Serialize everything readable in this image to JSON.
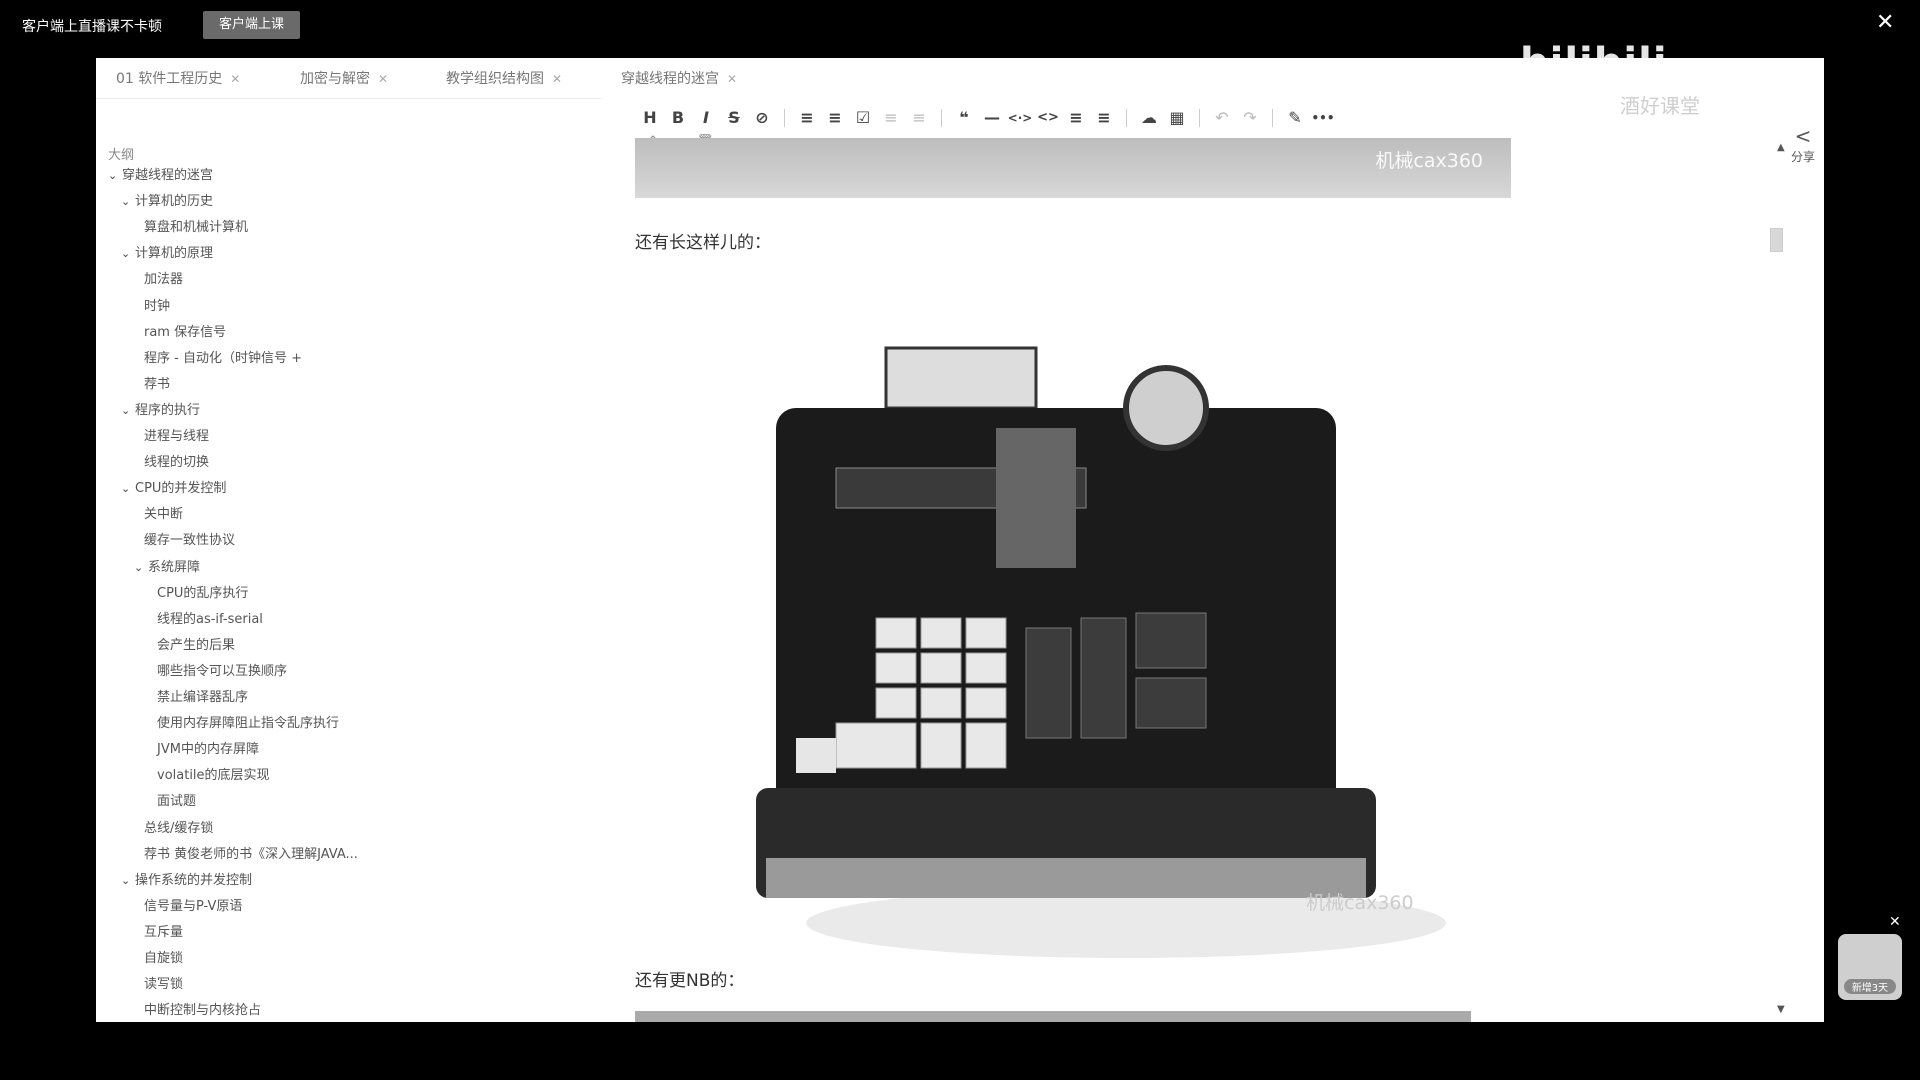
{
  "topbar": {
    "tip": "客户端上直播课不卡顿",
    "button": "客户端上课"
  },
  "tabs": [
    {
      "label": "01 软件工程历史"
    },
    {
      "label": "加密与解密"
    },
    {
      "label": "教学组织结构图"
    },
    {
      "label": "穿越线程的迷宫"
    }
  ],
  "outline": {
    "title": "大纲",
    "items": [
      {
        "label": "穿越线程的迷宫"
      },
      {
        "label": "计算机的历史"
      },
      {
        "label": "算盘和机械计算机"
      },
      {
        "label": "计算机的原理"
      },
      {
        "label": "加法器"
      },
      {
        "label": "时钟"
      },
      {
        "label": "ram 保存信号"
      },
      {
        "label": "程序 - 自动化（时钟信号 +"
      },
      {
        "label": "荐书"
      },
      {
        "label": "程序的执行"
      },
      {
        "label": "进程与线程"
      },
      {
        "label": "线程的切换"
      },
      {
        "label": "CPU的并发控制"
      },
      {
        "label": "关中断"
      },
      {
        "label": "缓存一致性协议"
      },
      {
        "label": "系统屏障"
      },
      {
        "label": "CPU的乱序执行"
      },
      {
        "label": "线程的as-if-serial"
      },
      {
        "label": "会产生的后果"
      },
      {
        "label": "哪些指令可以互换顺序"
      },
      {
        "label": "禁止编译器乱序"
      },
      {
        "label": "使用内存屏障阻止指令乱序执行"
      },
      {
        "label": "JVM中的内存屏障"
      },
      {
        "label": "volatile的底层实现"
      },
      {
        "label": "面试题"
      },
      {
        "label": "总线/缓存锁"
      },
      {
        "label": "荐书 黄俊老师的书《深入理解JAVA..."
      },
      {
        "label": "操作系统的并发控制"
      },
      {
        "label": "信号量与P-V原语"
      },
      {
        "label": "互斥量"
      },
      {
        "label": "自旋锁"
      },
      {
        "label": "读写锁"
      },
      {
        "label": "中断控制与内核抢占"
      }
    ]
  },
  "toolbar": {
    "heading": "H",
    "bold": "B",
    "italic": "I",
    "strike": "S",
    "link": "⊘",
    "ul": "≡",
    "ol": "≡",
    "task": "☑",
    "indent": "≡",
    "outdent": "≡",
    "quote": "❝",
    "hr": "—",
    "code": "<·>",
    "codeblock": "<>",
    "table_of": "≡",
    "clear": "≡",
    "cloud": "☁",
    "table": "▦",
    "undo": "↶",
    "redo": "↷",
    "pen": "✎",
    "more": "•••"
  },
  "subtool": [
    "⌃",
    "⌄",
    "🗑"
  ],
  "content": {
    "watermark_top": "机械cax360",
    "para1": "还有长这样儿的：",
    "watermark_img": "机械cax360",
    "para2": "还有更NB的："
  },
  "overlay": {
    "share": "分享",
    "logo": "bilibili",
    "school": "酒好课堂",
    "badge": "新增3天"
  }
}
